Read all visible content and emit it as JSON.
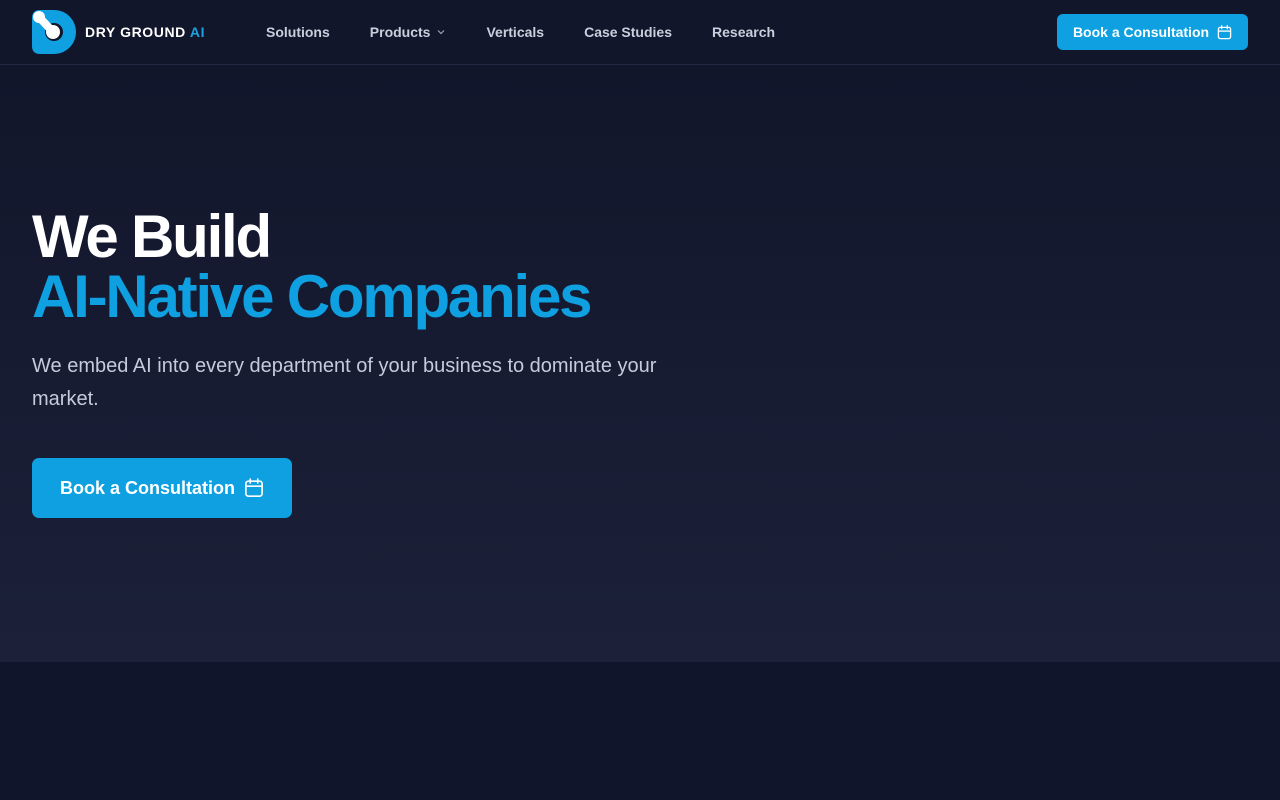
{
  "brand": {
    "name": "DRY GROUND",
    "name_accent": "AI",
    "accent_color": "#0ea0e0",
    "background_color": "#12162b"
  },
  "nav": {
    "links": [
      {
        "label": "Solutions",
        "has_dropdown": false
      },
      {
        "label": "Products",
        "has_dropdown": true
      },
      {
        "label": "Verticals",
        "has_dropdown": false
      },
      {
        "label": "Case Studies",
        "has_dropdown": false
      },
      {
        "label": "Research",
        "has_dropdown": false
      }
    ],
    "cta_label": "Book a Consultation",
    "cta_icon": "calendar-icon"
  },
  "hero": {
    "title_line1": "We Build",
    "title_line2": "AI-Native Companies",
    "subtitle": "We embed AI into every department of your business to dominate your market.",
    "cta_label": "Book a Consultation",
    "cta_icon": "calendar-icon"
  }
}
